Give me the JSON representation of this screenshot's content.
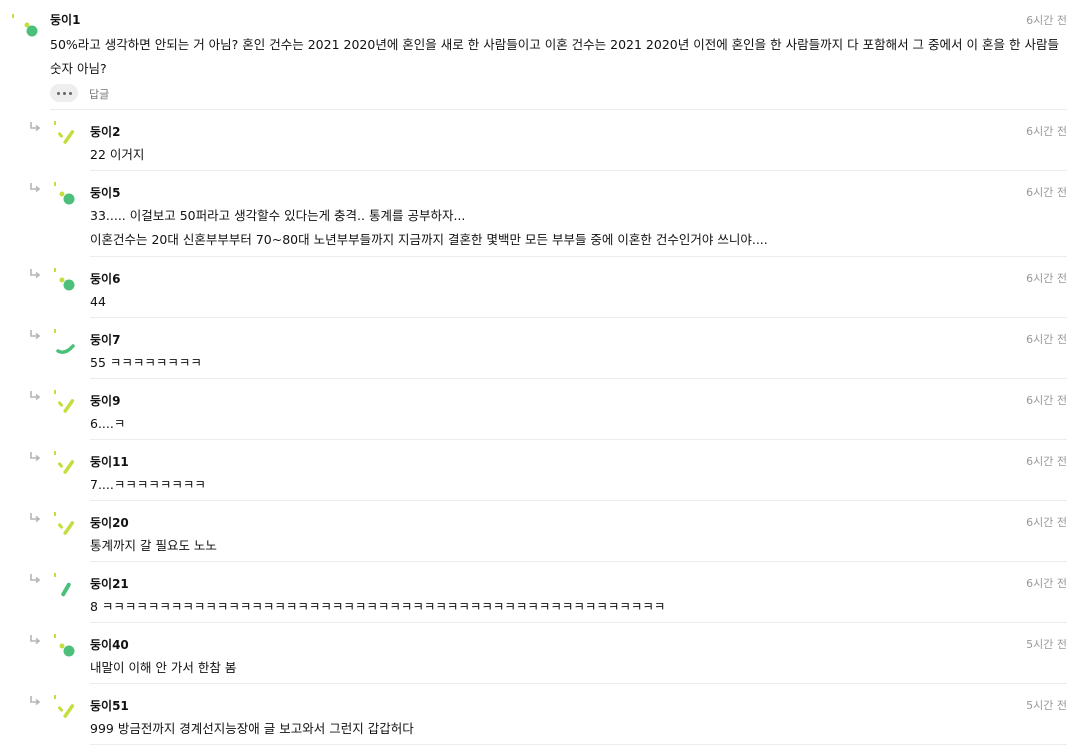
{
  "comments": {
    "top": {
      "nickname": "둥이1",
      "time": "6시간 전",
      "body_line1": "50%라고 생각하면 안되는 거 아님? 혼인 건수는 2021 2020년에 혼인을 새로 한 사람들이고 이혼 건수는 2021 2020년 이전에 혼인을 한 사람들까지 다 포함해서 그 중에서 이",
      "body_line2": "혼을 한 사람들 숫자 아님?",
      "more_icon": "ellipsis-icon",
      "reply_label": "답글"
    },
    "replies": [
      {
        "nickname": "둥이2",
        "time": "6시간 전",
        "line1": "22 이거지",
        "avatar": "lime-check"
      },
      {
        "nickname": "둥이5",
        "time": "6시간 전",
        "line1": "33..... 이걸보고 50퍼라고 생각할수 있다는게 충격.. 통계를 공부하자...",
        "line2": "이혼건수는 20대 신혼부부부터 70~80대 노년부부들까지 지금까지 결혼한 몇백만 모든 부부들 중에 이혼한 건수인거야 쓰니야....",
        "avatar": "green-dots"
      },
      {
        "nickname": "둥이6",
        "time": "6시간 전",
        "line1": "44",
        "avatar": "green-dots"
      },
      {
        "nickname": "둥이7",
        "time": "6시간 전",
        "line1": "55 ㅋㅋㅋㅋㅋㅋㅋㅋ",
        "avatar": "green-smile"
      },
      {
        "nickname": "둥이9",
        "time": "6시간 전",
        "line1": "6....ㅋ",
        "avatar": "lime-check"
      },
      {
        "nickname": "둥이11",
        "time": "6시간 전",
        "line1": "7....ㅋㅋㅋㅋㅋㅋㅋㅋ",
        "avatar": "lime-check"
      },
      {
        "nickname": "둥이20",
        "time": "6시간 전",
        "line1": "통계까지 갈 필요도 노노",
        "avatar": "lime-check"
      },
      {
        "nickname": "둥이21",
        "time": "6시간 전",
        "line1": "8 ㅋㅋㅋㅋㅋㅋㅋㅋㅋㅋㅋㅋㅋㅋㅋㅋㅋㅋㅋㅋㅋㅋㅋㅋㅋㅋㅋㅋㅋㅋㅋㅋㅋㅋㅋㅋㅋㅋㅋㅋㅋㅋㅋㅋㅋㅋㅋㅋㅋ",
        "avatar": "green-stroke"
      },
      {
        "nickname": "둥이40",
        "time": "5시간 전",
        "line1": "내말이 이해 안 가서 한참 봄",
        "avatar": "green-dots"
      },
      {
        "nickname": "둥이51",
        "time": "5시간 전",
        "line1": "999 방금전까지 경계선지능장애 글 보고와서 그런지 갑갑허다",
        "avatar": "lime-check"
      }
    ]
  },
  "colors": {
    "green": "#4cc07a",
    "lime": "#c2df3f",
    "separator": "#ececec",
    "time": "#999999"
  }
}
